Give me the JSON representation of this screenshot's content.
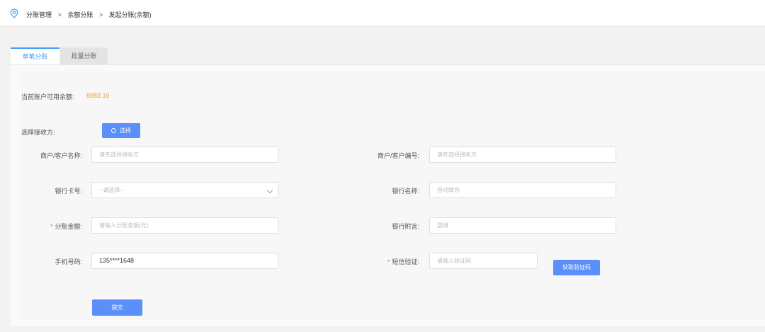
{
  "breadcrumb": {
    "items": [
      "分账管理",
      "余额分账",
      "发起分账(余额)"
    ],
    "separator": ">"
  },
  "tabs": [
    "单笔分账",
    "批量分账"
  ],
  "balance": {
    "label": "当前账户可用余额:",
    "value": "8983.15"
  },
  "receiver": {
    "label": "选择接收方:",
    "button": "选择"
  },
  "fields": {
    "merchant_name": {
      "label": "商户/客户名称:",
      "placeholder": "请先选择接收方"
    },
    "merchant_no": {
      "label": "商户/客户编号:",
      "placeholder": "请先选择接收方"
    },
    "bank_card": {
      "label": "银行卡号:",
      "placeholder": "--请选择--"
    },
    "bank_name": {
      "label": "银行名称:",
      "placeholder": "自动填充"
    },
    "amount": {
      "required": "*",
      "label": "分账金额:",
      "placeholder": "请输入分账金额(元)"
    },
    "bank_note": {
      "label": "银行附言:",
      "placeholder": "选填"
    },
    "phone": {
      "label": "手机号码:",
      "value": "135****1648"
    },
    "sms_code": {
      "required": "*",
      "label": "短信验证:",
      "placeholder": "请输入验证码",
      "button": "获取验证码"
    }
  },
  "submit_label": "提交",
  "colors": {
    "accent": "#409eff",
    "button": "#5b8ff9",
    "balance": "#e6a23c",
    "required": "#f56c6c"
  },
  "icons": [
    "location-pin-icon",
    "search-icon",
    "chevron-down-icon"
  ]
}
